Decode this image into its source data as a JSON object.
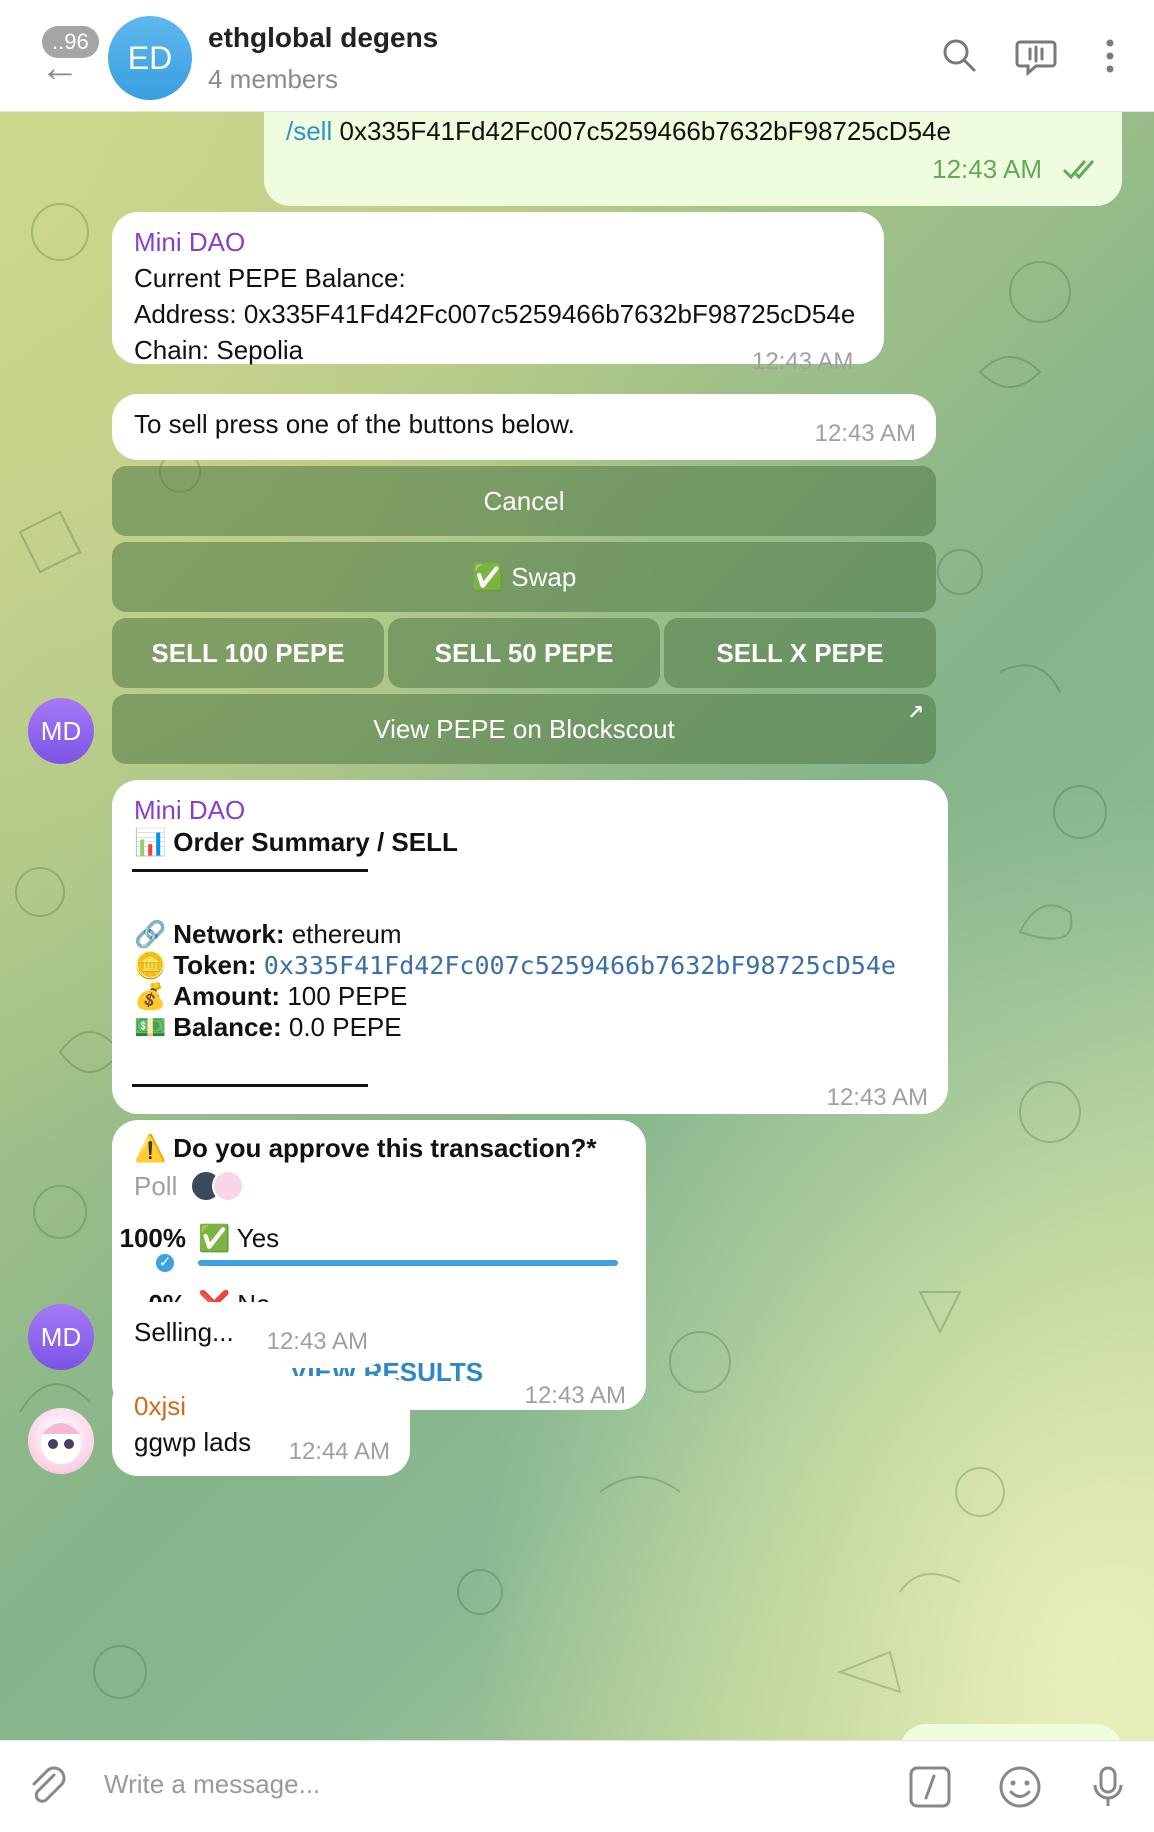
{
  "header": {
    "unread_count": "..96",
    "avatar_initials": "ED",
    "title": "ethglobal degens",
    "subtitle": "4 members"
  },
  "messages": {
    "outgoing": {
      "command": "/sell",
      "address": "0x335F41Fd42Fc007c5259466b7632bF98725cD54e",
      "time": "12:43 AM"
    },
    "balance": {
      "sender": "Mini DAO",
      "line1": "Current PEPE Balance:",
      "line2": "Address: 0x335F41Fd42Fc007c5259466b7632bF98725cD54e",
      "line3": "Chain: Sepolia",
      "time": "12:43 AM"
    },
    "sell_prompt": {
      "text": "To sell press one of the buttons below.",
      "time": "12:43 AM"
    },
    "keyboard": {
      "cancel": "Cancel",
      "swap_emoji": "✅",
      "swap": "Swap",
      "sell_100": "SELL 100 PEPE",
      "sell_50": "SELL 50 PEPE",
      "sell_x": "SELL X PEPE",
      "view": "View PEPE on Blockscout",
      "avatar_initials": "MD"
    },
    "summary": {
      "sender": "Mini DAO",
      "title_emoji": "📊",
      "title": "Order Summary / SELL",
      "network_emoji": "🔗",
      "network_label": "Network:",
      "network_value": "ethereum",
      "token_emoji": "🪙",
      "token_label": "Token:",
      "token_value": "0x335F41Fd42Fc007c5259466b7632bF98725cD54e",
      "amount_emoji": "💰",
      "amount_label": "Amount:",
      "amount_value": "100 PEPE",
      "balance_emoji": "💵",
      "balance_label": "Balance:",
      "balance_value": "0.0 PEPE",
      "time": "12:43 AM"
    },
    "poll": {
      "question_emoji": "⚠️",
      "question": "Do you approve this transaction?*",
      "type_label": "Poll",
      "options": [
        {
          "percent": "100%",
          "emoji": "✅",
          "label": "Yes",
          "share": 1.0
        },
        {
          "percent": "0%",
          "emoji": "❌",
          "label": "No",
          "share": 0.0
        }
      ],
      "view_results": "VIEW RESULTS",
      "time": "12:43 AM"
    },
    "selling": {
      "avatar_initials": "MD",
      "text": "Selling...",
      "time": "12:43 AM"
    },
    "ggwp": {
      "sender": "0xjsi",
      "text": "ggwp lads",
      "time": "12:44 AM"
    }
  },
  "composer": {
    "placeholder": "Write a message..."
  },
  "colors": {
    "accent": "#3390c8",
    "sender_bot": "#8a3fc8",
    "sender_user": "#d26a1e",
    "outgoing_bubble": "#effdde"
  }
}
